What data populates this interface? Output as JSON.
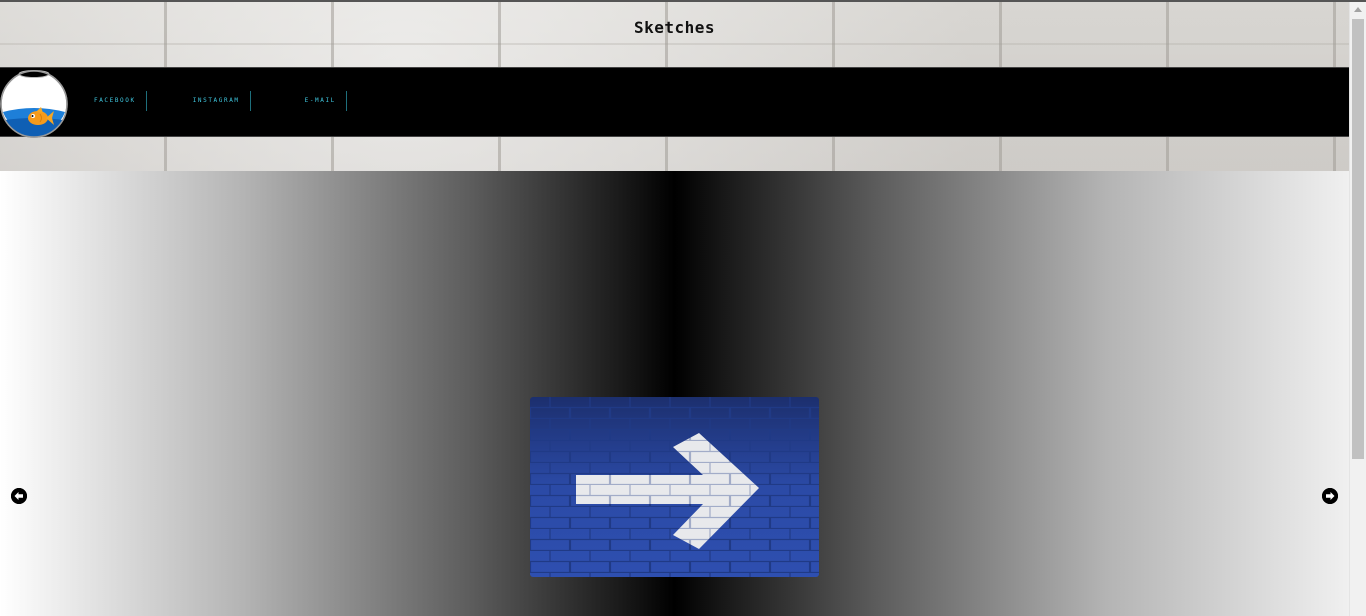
{
  "header": {
    "title": "Sketches"
  },
  "nav": {
    "logo_icon": "fishbowl-logo-icon",
    "links": [
      {
        "label": "FACEBOOK"
      },
      {
        "label": "INSTAGRAM"
      },
      {
        "label": "E-MAIL"
      }
    ],
    "link_color": "#3fc6de"
  },
  "slider": {
    "image_icon": "white-arrow-on-blue-brick-image",
    "prev_icon": "arrow-left-circle-icon",
    "next_icon": "arrow-right-circle-icon"
  },
  "colors": {
    "navbar_bg": "#000000",
    "brick_wall": "#d6d4d0",
    "image_blue": "#2a48a0"
  }
}
